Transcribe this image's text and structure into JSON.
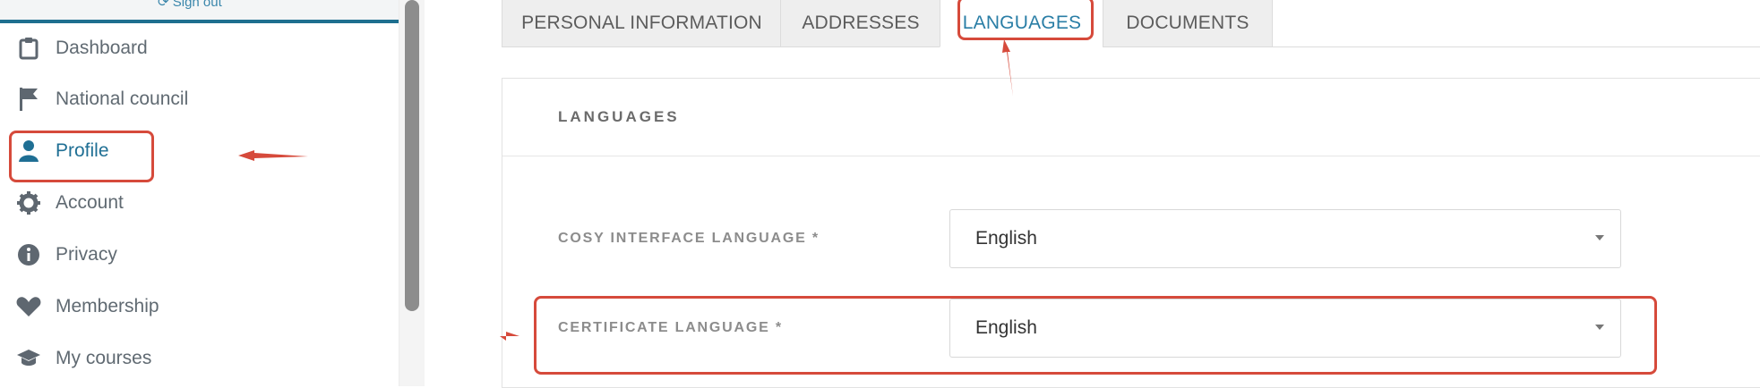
{
  "sidebar": {
    "sign_out": "⟳ Sign out",
    "items": [
      {
        "label": "Dashboard",
        "icon": "clipboard-icon"
      },
      {
        "label": "National council",
        "icon": "flag-icon"
      },
      {
        "label": "Profile",
        "icon": "user-icon"
      },
      {
        "label": "Account",
        "icon": "gear-icon"
      },
      {
        "label": "Privacy",
        "icon": "info-icon"
      },
      {
        "label": "Membership",
        "icon": "heart-icon"
      },
      {
        "label": "My courses",
        "icon": "graduation-cap-icon"
      }
    ],
    "active_index": 2
  },
  "tabs": [
    {
      "label": "PERSONAL INFORMATION"
    },
    {
      "label": "ADDRESSES"
    },
    {
      "label": "LANGUAGES"
    },
    {
      "label": "DOCUMENTS"
    }
  ],
  "active_tab": 2,
  "panel": {
    "title": "LANGUAGES",
    "fields": [
      {
        "label": "COSY INTERFACE LANGUAGE *",
        "value": "English"
      },
      {
        "label": "CERTIFICATE LANGUAGE *",
        "value": "English"
      }
    ]
  },
  "colors": {
    "accent": "#1f6f94",
    "annotation": "#d64a3b"
  }
}
